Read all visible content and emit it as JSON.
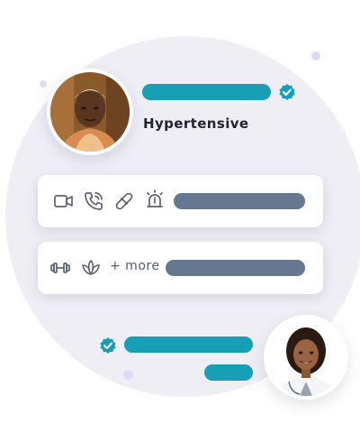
{
  "patient": {
    "condition": "Hypertensive",
    "verified": true
  },
  "services": {
    "row1_icons": [
      "video-call-icon",
      "phone-call-icon",
      "pill-icon",
      "emergency-alarm-icon"
    ],
    "row2_icons": [
      "fitness-dumbbell-icon",
      "wellness-lotus-icon"
    ],
    "more_label": "+ more"
  },
  "doctor": {
    "verified": true
  },
  "colors": {
    "accent": "#17a0b5",
    "placeholder": "#657791",
    "icon": "#5a6275",
    "background_circle": "#efeef5"
  }
}
